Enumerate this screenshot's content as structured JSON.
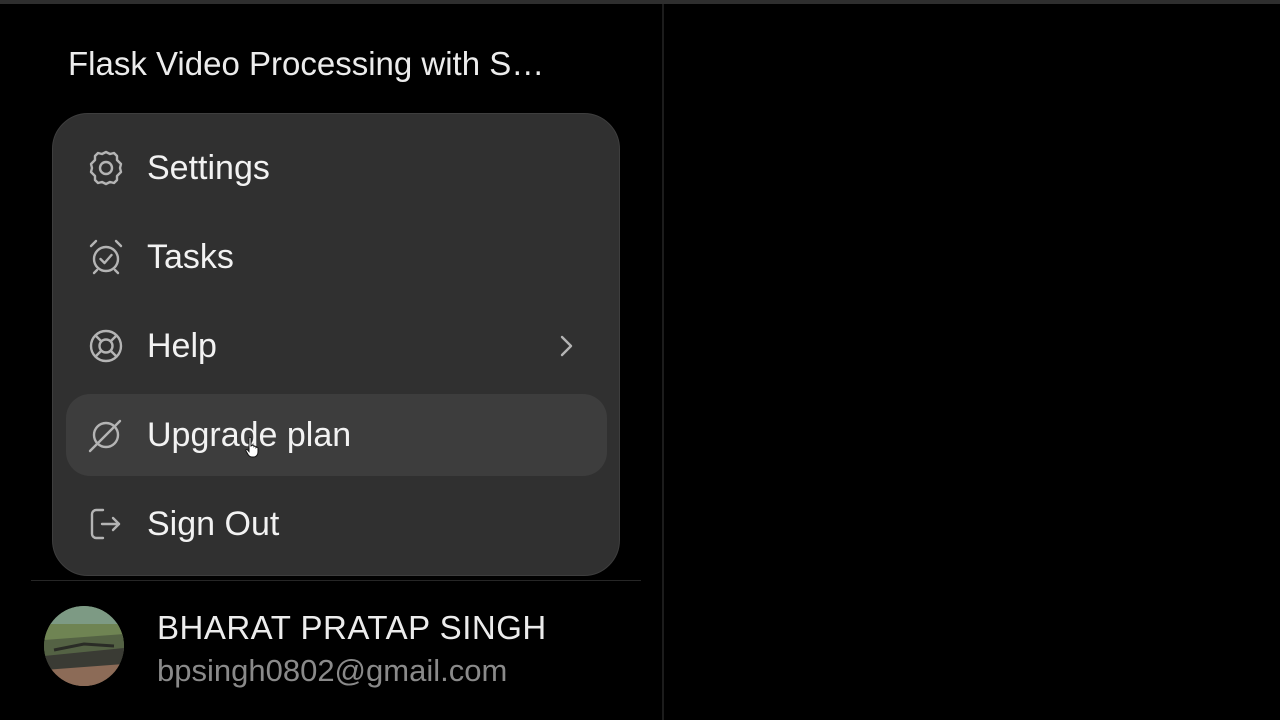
{
  "chat": {
    "title": "Flask Video Processing with S…"
  },
  "menu": {
    "items": [
      {
        "label": "Settings",
        "icon": "gear-icon"
      },
      {
        "label": "Tasks",
        "icon": "alarm-clock-icon"
      },
      {
        "label": "Help",
        "icon": "lifebuoy-icon",
        "has_submenu": true
      },
      {
        "label": "Upgrade plan",
        "icon": "upgrade-icon",
        "hovered": true
      },
      {
        "label": "Sign Out",
        "icon": "sign-out-icon"
      }
    ]
  },
  "user": {
    "name": "BHARAT PRATAP SINGH",
    "email": "bpsingh0802@gmail.com"
  },
  "colors": {
    "background": "#000000",
    "menu_background": "#303030",
    "hover_background": "#3d3d3d",
    "text_primary": "#f2f2f2",
    "text_secondary": "#8a8a8a"
  }
}
